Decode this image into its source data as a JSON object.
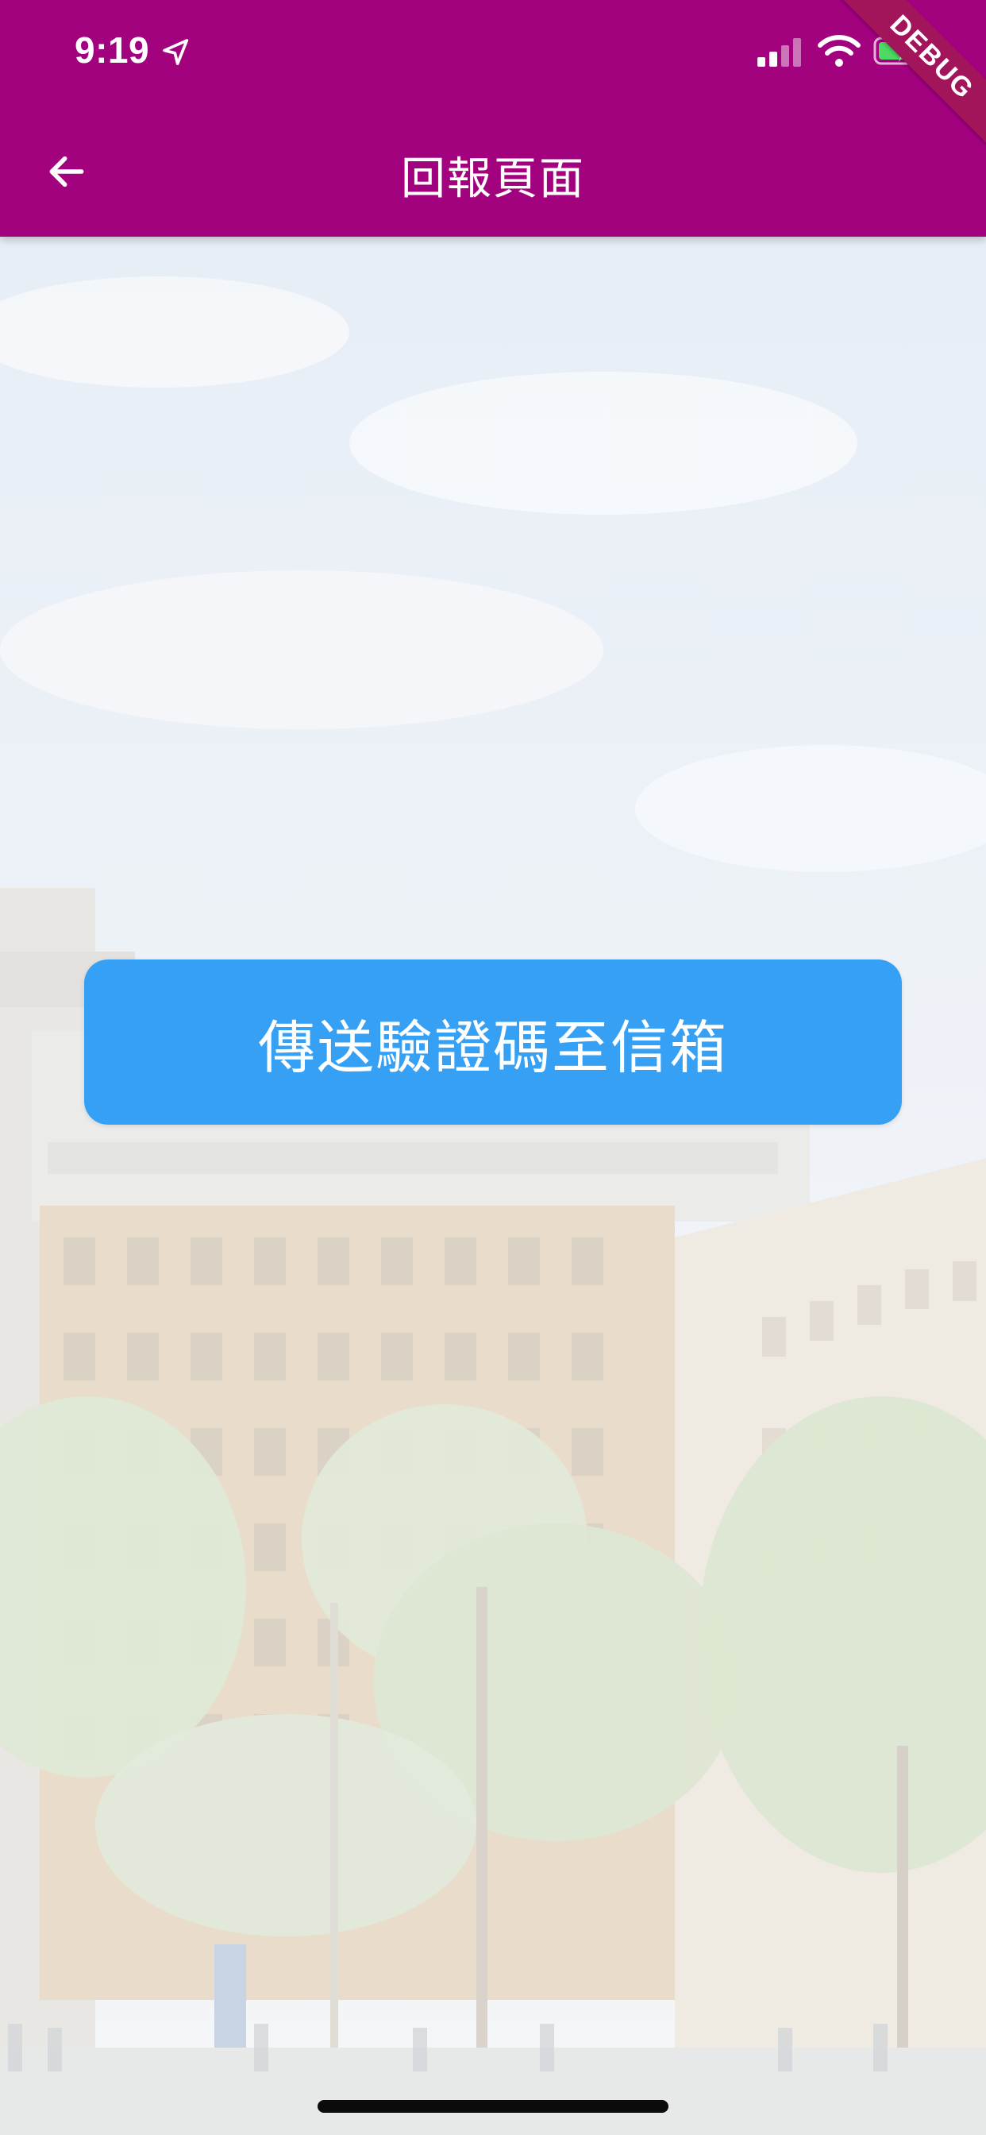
{
  "status_bar": {
    "time": "9:19",
    "icons": [
      "location-arrow-icon",
      "cellular-signal-icon",
      "wifi-icon",
      "battery-charging-icon"
    ]
  },
  "debug_banner": {
    "label": "DEBUG"
  },
  "app_bar": {
    "back_icon": "arrow-left-icon",
    "title": "回報頁面",
    "background_color": "#a3027f"
  },
  "main": {
    "send_button_label": "傳送驗證碼至信箱",
    "send_button_color": "#36a0f5"
  }
}
